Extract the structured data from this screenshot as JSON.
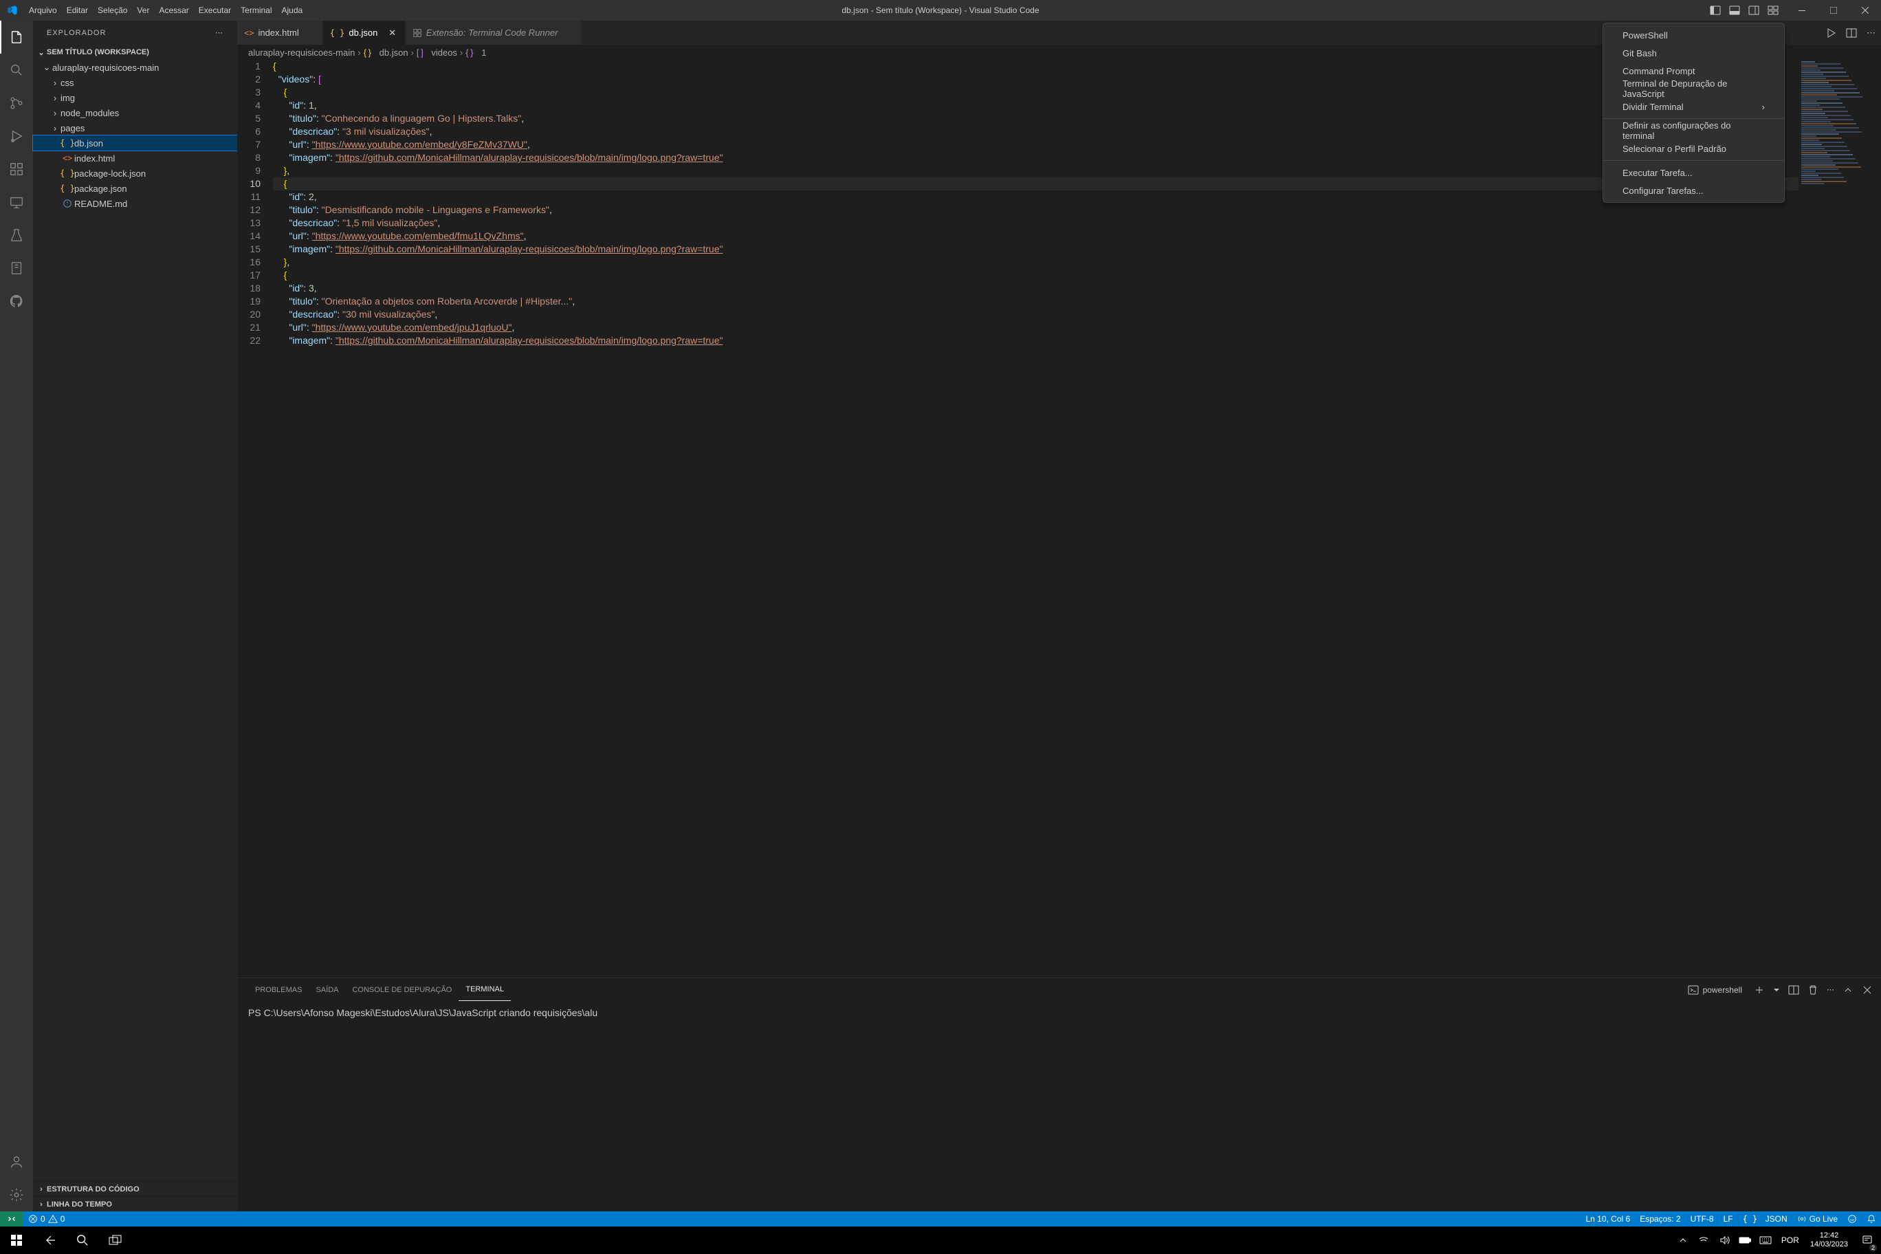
{
  "title_bar": {
    "menu": [
      "Arquivo",
      "Editar",
      "Seleção",
      "Ver",
      "Acessar",
      "Executar",
      "Terminal",
      "Ajuda"
    ],
    "title": "db.json - Sem título (Workspace) - Visual Studio Code"
  },
  "sidebar": {
    "header": "EXPLORADOR",
    "workspace": "SEM TÍTULO (WORKSPACE)",
    "root_folder": "aluraplay-requisicoes-main",
    "folders": [
      "css",
      "img",
      "node_modules",
      "pages"
    ],
    "files": [
      {
        "name": "db.json",
        "icon": "json",
        "active": true
      },
      {
        "name": "index.html",
        "icon": "html"
      },
      {
        "name": "package-lock.json",
        "icon": "json"
      },
      {
        "name": "package.json",
        "icon": "json"
      },
      {
        "name": "README.md",
        "icon": "md"
      }
    ],
    "outline": "ESTRUTURA DO CÓDIGO",
    "timeline": "LINHA DO TEMPO"
  },
  "tabs": [
    {
      "label": "index.html",
      "icon": "html"
    },
    {
      "label": "db.json",
      "icon": "json",
      "active": true
    },
    {
      "label": "Extensão: Terminal Code Runner",
      "ext": true
    }
  ],
  "breadcrumb": {
    "p1": "aluraplay-requisicoes-main",
    "p2": "db.json",
    "p3": "videos",
    "p4": "1"
  },
  "code_lines": [
    "{",
    "  \"videos\": [",
    "    {",
    "      \"id\": 1,",
    "      \"titulo\": \"Conhecendo a linguagem Go | Hipsters.Talks\",",
    "      \"descricao\": \"3 mil visualizações\",",
    "      \"url\": \"https://www.youtube.com/embed/y8FeZMv37WU\",",
    "      \"imagem\": \"https://github.com/MonicaHillman/aluraplay-requisicoes/blob/main/img/logo.png?raw=true\"",
    "    },",
    "    {",
    "      \"id\": 2,",
    "      \"titulo\": \"Desmistificando mobile - Linguagens e Frameworks\",",
    "      \"descricao\": \"1,5 mil visualizações\",",
    "      \"url\": \"https://www.youtube.com/embed/fmu1LQvZhms\",",
    "      \"imagem\": \"https://github.com/MonicaHillman/aluraplay-requisicoes/blob/main/img/logo.png?raw=true\"",
    "    },",
    "    {",
    "      \"id\": 3,",
    "      \"titulo\": \"Orientação a objetos com Roberta Arcoverde | #Hipster...\",",
    "      \"descricao\": \"30 mil visualizações\",",
    "      \"url\": \"https://www.youtube.com/embed/jpuJ1qrluoU\",",
    "      \"imagem\": \"https://github.com/MonicaHillman/aluraplay-requisicoes/blob/main/img/logo.png?raw=true\""
  ],
  "cursor_line": 10,
  "panel": {
    "tabs": [
      "PROBLEMAS",
      "SAÍDA",
      "CONSOLE DE DEPURAÇÃO",
      "TERMINAL"
    ],
    "active_tab": 3,
    "shell_label": "powershell",
    "terminal_line": "PS C:\\Users\\Afonso Mageski\\Estudos\\Alura\\JS\\JavaScript criando requisições\\alu"
  },
  "context_menu": {
    "group1": [
      "PowerShell",
      "Git Bash",
      "Command Prompt",
      "Terminal de Depuração de JavaScript"
    ],
    "split": "Dividir Terminal",
    "group2": [
      "Definir as configurações do terminal",
      "Selecionar o Perfil Padrão"
    ],
    "group3": [
      "Executar Tarefa...",
      "Configurar Tarefas..."
    ]
  },
  "status": {
    "errors": "0",
    "warnings": "0",
    "ln_col": "Ln 10, Col 6",
    "spaces": "Espaços: 2",
    "encoding": "UTF-8",
    "eol": "LF",
    "lang": "JSON",
    "golive": "Go Live"
  },
  "taskbar": {
    "lang": "POR",
    "time": "12:42",
    "date": "14/03/2023",
    "notif_count": "2"
  }
}
